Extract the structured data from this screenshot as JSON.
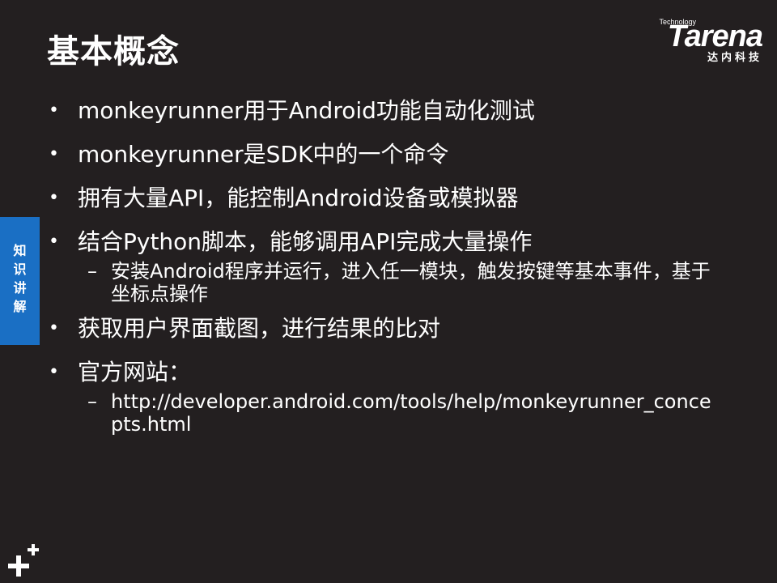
{
  "title": "基本概念",
  "logo": {
    "tech": "Technology",
    "word": "Tarena",
    "cn": "达内科技"
  },
  "side_tab": {
    "chars": [
      "知",
      "识",
      "讲",
      "解"
    ]
  },
  "bullets": [
    {
      "text": "monkeyrunner用于Android功能自动化测试"
    },
    {
      "text": "monkeyrunner是SDK中的一个命令"
    },
    {
      "text": "拥有大量API，能控制Android设备或模拟器"
    },
    {
      "text": "结合Python脚本，能够调用API完成大量操作",
      "sub": "安装Android程序并运行，进入任一模块，触发按键等基本事件，基于坐标点操作"
    },
    {
      "text": "获取用户界面截图，进行结果的比对"
    },
    {
      "text": "官方网站：",
      "sub": "http://developer.android.com/tools/help/monkeyrunner_concepts.html"
    }
  ],
  "bullet_glyph": "•",
  "sub_glyph": "–",
  "colors": {
    "background": "#231f20",
    "text": "#ffffff",
    "tab": "#1a6fc4"
  }
}
